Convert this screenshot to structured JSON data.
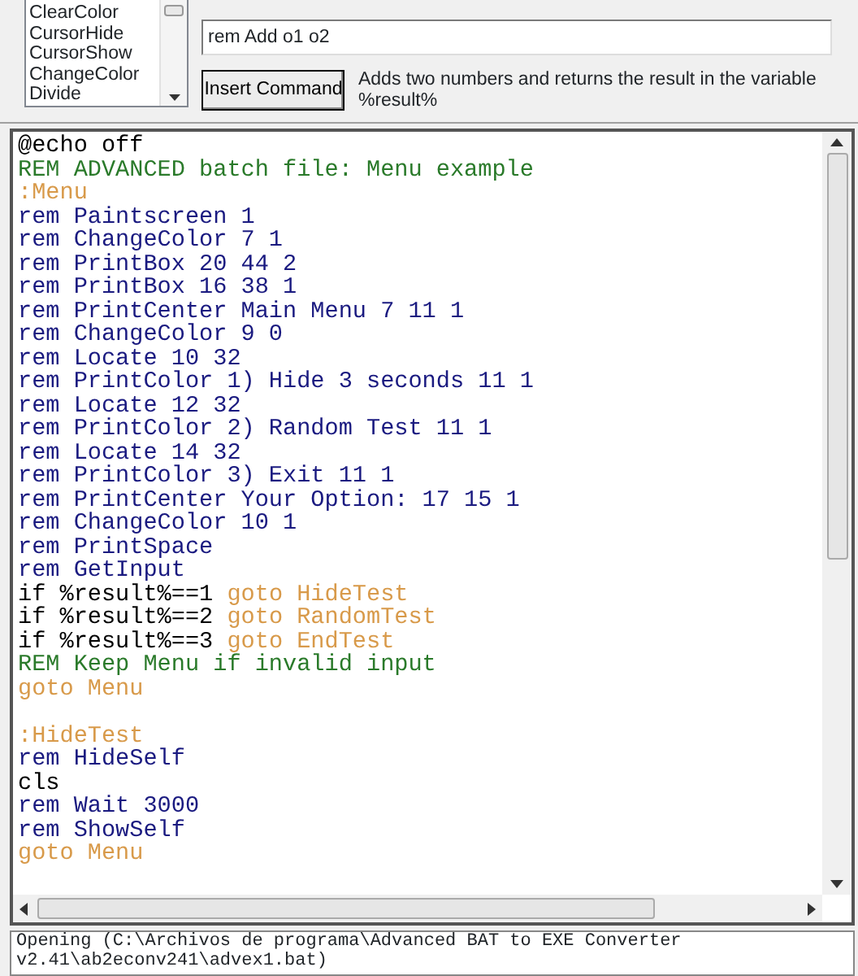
{
  "command_list": {
    "items": [
      {
        "label": "ClearColor",
        "selected": false
      },
      {
        "label": "CursorHide",
        "selected": false
      },
      {
        "label": "CursorShow",
        "selected": false
      },
      {
        "label": "ChangeColor",
        "selected": false
      },
      {
        "label": "Divide",
        "selected": false
      }
    ]
  },
  "command_field": {
    "value": "rem Add o1 o2"
  },
  "insert_button": {
    "label": "Insert Command"
  },
  "description": "Adds two numbers and returns the result in the variable %result%",
  "editor": {
    "lines": [
      [
        {
          "text": "@echo off",
          "kind": "plain"
        }
      ],
      [
        {
          "text": "REM ADVANCED batch file: Menu example",
          "kind": "comment"
        }
      ],
      [
        {
          "text": ":Menu",
          "kind": "label"
        }
      ],
      [
        {
          "text": "rem Paintscreen 1",
          "kind": "command"
        }
      ],
      [
        {
          "text": "rem ChangeColor 7 1",
          "kind": "command"
        }
      ],
      [
        {
          "text": "rem PrintBox 20 44 2",
          "kind": "command"
        }
      ],
      [
        {
          "text": "rem PrintBox 16 38 1",
          "kind": "command"
        }
      ],
      [
        {
          "text": "rem PrintCenter Main Menu 7 11 1",
          "kind": "command"
        }
      ],
      [
        {
          "text": "rem ChangeColor 9 0",
          "kind": "command"
        }
      ],
      [
        {
          "text": "rem Locate 10 32",
          "kind": "command"
        }
      ],
      [
        {
          "text": "rem PrintColor 1) Hide 3 seconds 11 1",
          "kind": "command"
        }
      ],
      [
        {
          "text": "rem Locate 12 32",
          "kind": "command"
        }
      ],
      [
        {
          "text": "rem PrintColor 2) Random Test 11 1",
          "kind": "command"
        }
      ],
      [
        {
          "text": "rem Locate 14 32",
          "kind": "command"
        }
      ],
      [
        {
          "text": "rem PrintColor 3) Exit 11 1",
          "kind": "command"
        }
      ],
      [
        {
          "text": "rem PrintCenter Your Option: 17 15 1",
          "kind": "command"
        }
      ],
      [
        {
          "text": "rem ChangeColor 10 1",
          "kind": "command"
        }
      ],
      [
        {
          "text": "rem PrintSpace",
          "kind": "command"
        }
      ],
      [
        {
          "text": "rem GetInput",
          "kind": "command"
        }
      ],
      [
        {
          "text": "if %result%==1 ",
          "kind": "plain"
        },
        {
          "text": "goto HideTest",
          "kind": "label"
        }
      ],
      [
        {
          "text": "if %result%==2 ",
          "kind": "plain"
        },
        {
          "text": "goto RandomTest",
          "kind": "label"
        }
      ],
      [
        {
          "text": "if %result%==3 ",
          "kind": "plain"
        },
        {
          "text": "goto EndTest",
          "kind": "label"
        }
      ],
      [
        {
          "text": "REM Keep Menu if invalid input",
          "kind": "comment"
        }
      ],
      [
        {
          "text": "goto Menu",
          "kind": "label"
        }
      ],
      [
        {
          "text": ":HideTest",
          "kind": "label",
          "space_before": true
        }
      ],
      [
        {
          "text": "rem HideSelf",
          "kind": "command"
        }
      ],
      [
        {
          "text": "cls",
          "kind": "plain"
        }
      ],
      [
        {
          "text": "rem Wait 3000",
          "kind": "command"
        }
      ],
      [
        {
          "text": "rem ShowSelf",
          "kind": "command"
        }
      ],
      [
        {
          "text": "goto Menu",
          "kind": "label"
        }
      ]
    ]
  },
  "log": {
    "lines": [
      "Opening (C:\\Archivos de programa\\Advanced BAT to EXE Converter",
      "v2.41\\ab2econv241\\advex1.bat)"
    ]
  }
}
